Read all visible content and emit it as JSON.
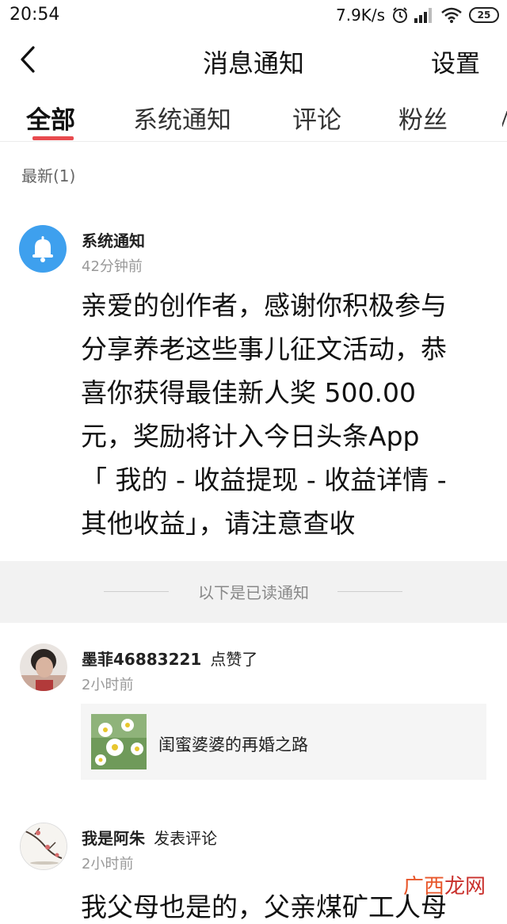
{
  "status_bar": {
    "time": "20:54",
    "network_speed": "7.9K/s",
    "battery_level": "25",
    "icons": [
      "alarm-icon",
      "signal-icon",
      "wifi-icon",
      "battery-icon"
    ]
  },
  "nav": {
    "back_icon": "chevron-left-icon",
    "title": "消息通知",
    "settings_label": "设置"
  },
  "tabs": [
    {
      "label": "全部",
      "active": true
    },
    {
      "label": "系统通知",
      "active": false
    },
    {
      "label": "评论",
      "active": false
    },
    {
      "label": "粉丝",
      "active": false
    }
  ],
  "colors": {
    "accent": "#e84a4e",
    "system_avatar": "#3ea0ee",
    "band": "#f2f2f2",
    "watermark": "#e8562a"
  },
  "latest": {
    "label": "最新(1)",
    "notification": {
      "icon": "bell-icon",
      "title": "系统通知",
      "time": "42分钟前",
      "body_lines": [
        "亲爱的创作者，感谢你积极参与",
        "分享养老这些事儿征文活动，恭",
        "喜你获得最佳新人奖 500.00",
        "元，奖励将计入今日头条App",
        "「 我的 - 收益提现 - 收益详情 -",
        "其他收益」，请注意查收"
      ]
    }
  },
  "read_separator": "以下是已读通知",
  "notifications": [
    {
      "name": "墨菲46883221",
      "action": "点赞了",
      "time": "2小时前",
      "article_title": "闺蜜婆婆的再婚之路"
    },
    {
      "name": "我是阿朱",
      "action": "发表评论",
      "time": "2小时前",
      "preview": "我父母也是的，父亲煤矿工人母"
    }
  ],
  "watermark": {
    "part1": "广西",
    "part2": "龙网"
  }
}
